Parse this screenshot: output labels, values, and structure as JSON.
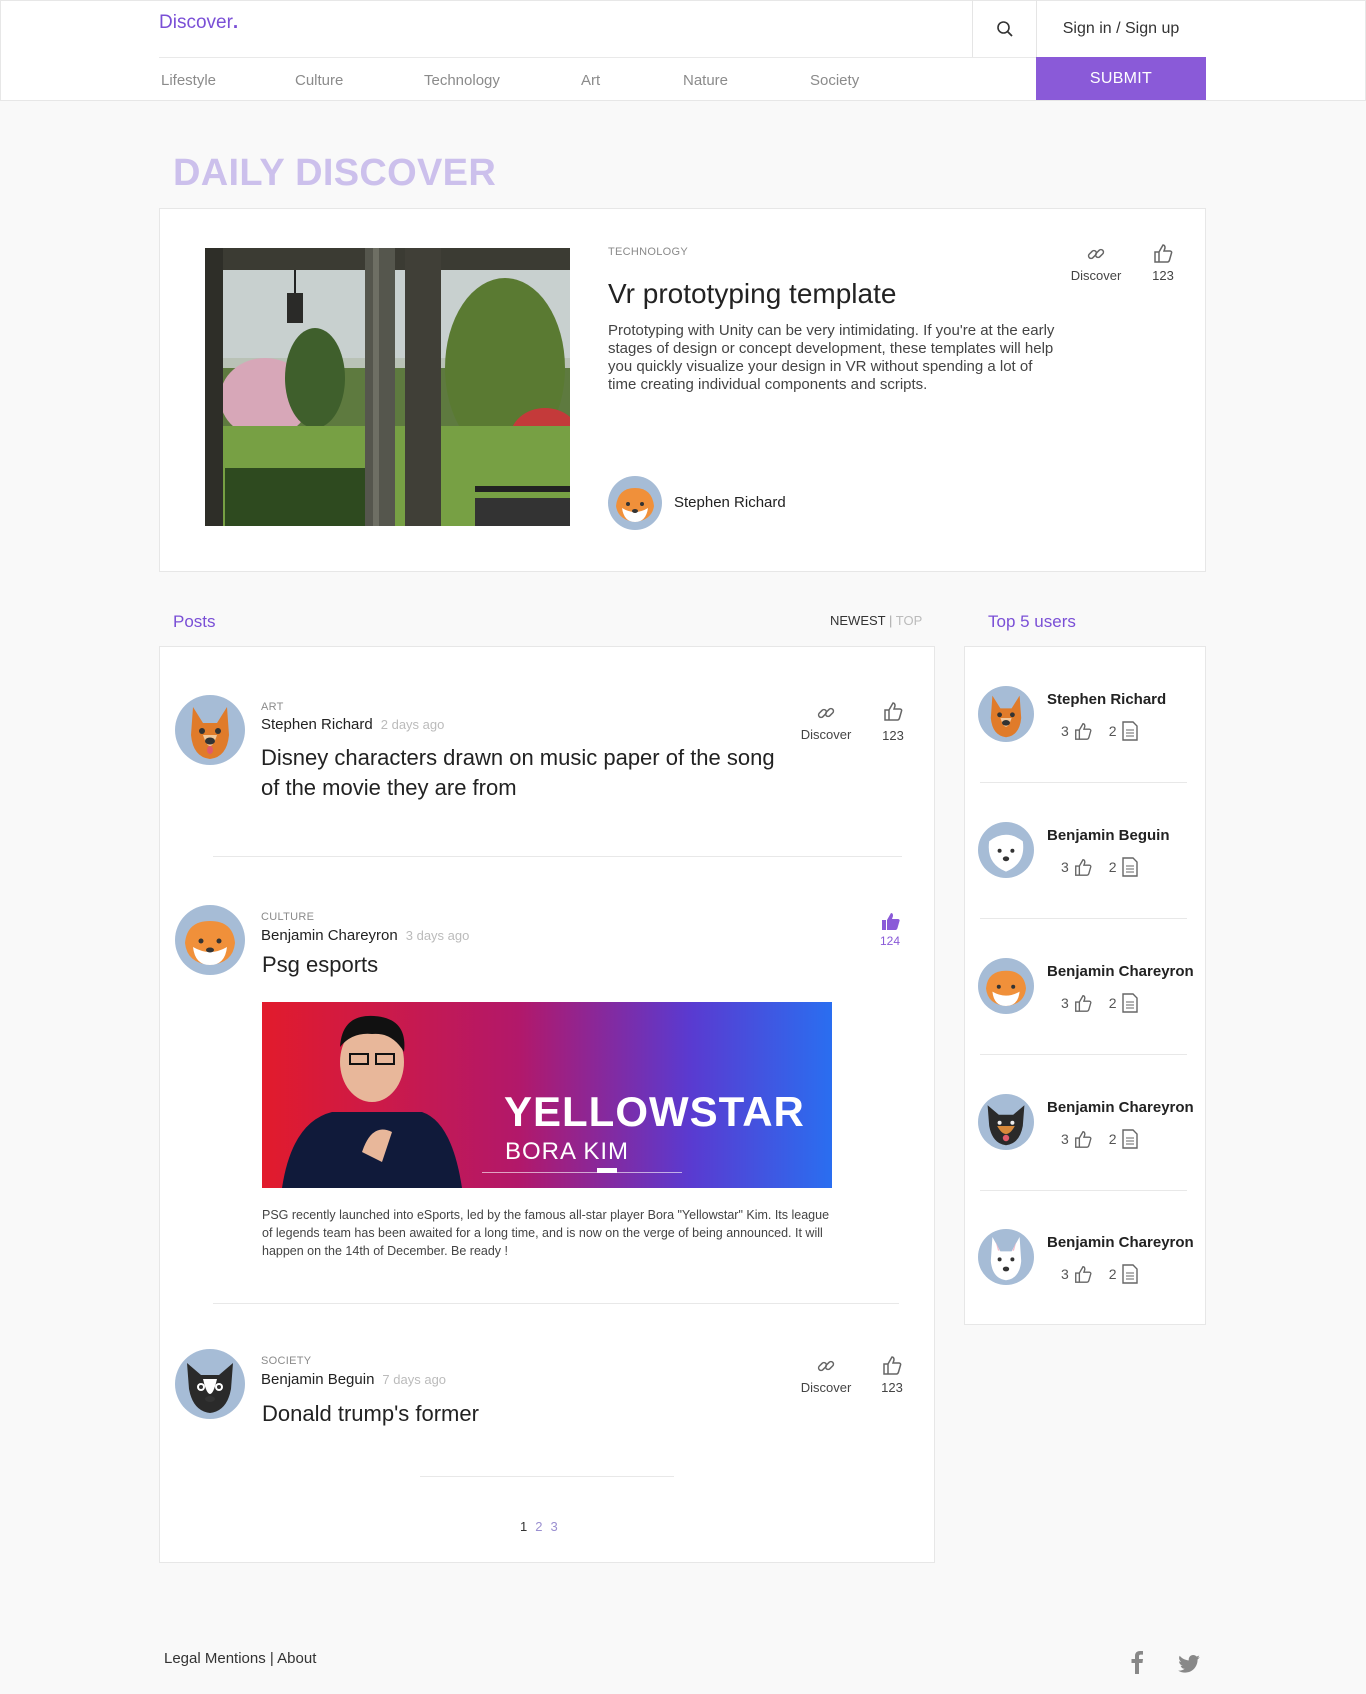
{
  "header": {
    "logo": "Discover",
    "logo_dot": ".",
    "signin_label": "Sign in / Sign up",
    "submit_label": "SUBMIT",
    "nav": [
      "Lifestyle",
      "Culture",
      "Technology",
      "Art",
      "Nature",
      "Society"
    ]
  },
  "featured": {
    "section_title": "DAILY DISCOVER",
    "category": "TECHNOLOGY",
    "title": "Vr prototyping template",
    "description": "Prototyping with Unity can be very intimidating. If you're at the early stages of design or concept development, these templates will help you quickly visualize your design in VR without spending a lot of time creating individual components and scripts.",
    "author": "Stephen Richard",
    "discover_label": "Discover",
    "likes": "123"
  },
  "posts_section": {
    "title": "Posts",
    "sort_newest": "NEWEST",
    "sort_sep": "|",
    "sort_top": "TOP"
  },
  "posts": [
    {
      "category": "ART",
      "author": "Stephen Richard",
      "ago": "2 days ago",
      "title": "Disney characters drawn on music paper of the song of the movie they are from",
      "discover_label": "Discover",
      "likes": "123"
    },
    {
      "category": "CULTURE",
      "author": "Benjamin Chareyron",
      "ago": "3 days ago",
      "title": "Psg esports",
      "likes": "124",
      "image_title": "YELLOWSTAR",
      "image_subtitle": "BORA KIM",
      "description": "PSG recently launched into eSports, led by the famous all-star player Bora \"Yellowstar\" Kim. Its league of legends team has been awaited for a long time, and is now on the verge of being announced. It will happen on the 14th of December. Be ready !"
    },
    {
      "category": "SOCIETY",
      "author": "Benjamin Beguin",
      "ago": "7 days ago",
      "title": "Donald trump's former",
      "discover_label": "Discover",
      "likes": "123"
    }
  ],
  "pagination": [
    "1",
    "2",
    "3"
  ],
  "top_users": {
    "title": "Top 5 users",
    "users": [
      {
        "name": "Stephen Richard",
        "likes": "3",
        "posts": "2"
      },
      {
        "name": "Benjamin Beguin",
        "likes": "3",
        "posts": "2"
      },
      {
        "name": "Benjamin Chareyron",
        "likes": "3",
        "posts": "2"
      },
      {
        "name": "Benjamin Chareyron",
        "likes": "3",
        "posts": "2"
      },
      {
        "name": "Benjamin Chareyron",
        "likes": "3",
        "posts": "2"
      }
    ]
  },
  "footer": {
    "legal": "Legal Mentions",
    "sep": "|",
    "about": "About"
  },
  "colors": {
    "accent": "#8a5ad8",
    "title_light": "#ccc0ec",
    "avatar_bg": "#a6bcd6"
  }
}
